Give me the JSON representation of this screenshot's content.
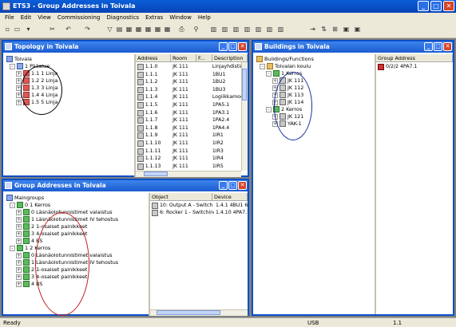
{
  "app": {
    "title": "ETS3 - Group Addresses in Toivala",
    "menu": [
      "File",
      "Edit",
      "View",
      "Commissioning",
      "Diagnostics",
      "Extras",
      "Window",
      "Help"
    ]
  },
  "toolbar": {
    "icons": [
      "new-icon",
      "open-icon",
      "save-dropdown-icon",
      "cut-icon",
      "undo-icon",
      "redo-icon",
      "filter-icon",
      "properties-icon",
      "view1-icon",
      "view2-icon",
      "view3-icon",
      "view4-icon",
      "print-icon",
      "find-icon",
      "grid1-icon",
      "grid2-icon",
      "grid3-icon",
      "grid4-icon",
      "grid5-icon",
      "grid6-icon",
      "grid7-icon",
      "program-icon",
      "compare-icon",
      "bus-icon",
      "monitor-icon",
      "mode-icon"
    ]
  },
  "topology": {
    "title": "Topology in Toivala",
    "tree": {
      "root": "Toivala",
      "area": "1 Pääalue",
      "lines": [
        "1.1 1 Linja",
        "1.2 2 Linja",
        "1.3 3 Linja",
        "1.4 4 Linja",
        "1.5 5 Linja"
      ]
    },
    "columns": [
      "Address",
      "Room",
      "F...",
      "Description"
    ],
    "rows": [
      [
        "1.1.0",
        "JK 111",
        "",
        "Linjayhdistin"
      ],
      [
        "1.1.1",
        "JK 111",
        "",
        "1BU1"
      ],
      [
        "1.1.2",
        "JK 111",
        "",
        "1BU2"
      ],
      [
        "1.1.3",
        "JK 111",
        "",
        "1BU3"
      ],
      [
        "1.1.4",
        "JK 111",
        "",
        "Logiikkamodul"
      ],
      [
        "1.1.5",
        "JK 111",
        "",
        "1PA5.1"
      ],
      [
        "1.1.6",
        "JK 111",
        "",
        "1PA3.1"
      ],
      [
        "1.1.7",
        "JK 111",
        "",
        "1PA2.4"
      ],
      [
        "1.1.8",
        "JK 111",
        "",
        "1PA4.4"
      ],
      [
        "1.1.9",
        "JK 111",
        "",
        "1IR1"
      ],
      [
        "1.1.10",
        "JK 111",
        "",
        "1IR2"
      ],
      [
        "1.1.11",
        "JK 111",
        "",
        "1IR3"
      ],
      [
        "1.1.12",
        "JK 111",
        "",
        "1IR4"
      ],
      [
        "1.1.13",
        "JK 111",
        "",
        "1IR5"
      ]
    ]
  },
  "buildings": {
    "title": "Buildings in Toivala",
    "tree": {
      "root": "Buildings/Functions",
      "building": "Toivalan koulu",
      "floor1": "1 Kerros",
      "rooms1": [
        "JK 111",
        "JK 112",
        "JK 113",
        "JK 114"
      ],
      "floor2": "2 Kerros",
      "rooms2": [
        "JK 121",
        "YAK-1"
      ]
    },
    "columns": [
      "Group Address"
    ],
    "rows": [
      "0/2/2 4PA7.1"
    ]
  },
  "groupaddresses": {
    "title": "Group Addresses in Toivala",
    "tree": {
      "root": "Maingroups",
      "main0": "0 1 Kerros",
      "main0_items": [
        "0 Läsnäolotunnistimet valaistus",
        "1 Läsnäolotunnistimet IV tehostus",
        "2 1-osaiset painikkeet",
        "3 4-osaiset painikkeet",
        "4 BS"
      ],
      "main1": "1 2 Kerros",
      "main1_items": [
        "0 Läsnäolotunnistimet valaistus",
        "1 Läsnäolotunnistimet IV tehostus",
        "2 1-osaiset painikkeet",
        "3 4-osaiset painikkeet",
        "4 BS"
      ]
    },
    "columns": [
      "Object",
      "Device"
    ],
    "rows": [
      [
        "10: Output A - Switch",
        "1.4.1 4BU1 61946"
      ],
      [
        "6: Rocker 1 - Switching",
        "1.4.10 4PA7.1"
      ]
    ]
  },
  "status": {
    "left": "Ready",
    "usb": "USB",
    "addr": "1.1"
  }
}
